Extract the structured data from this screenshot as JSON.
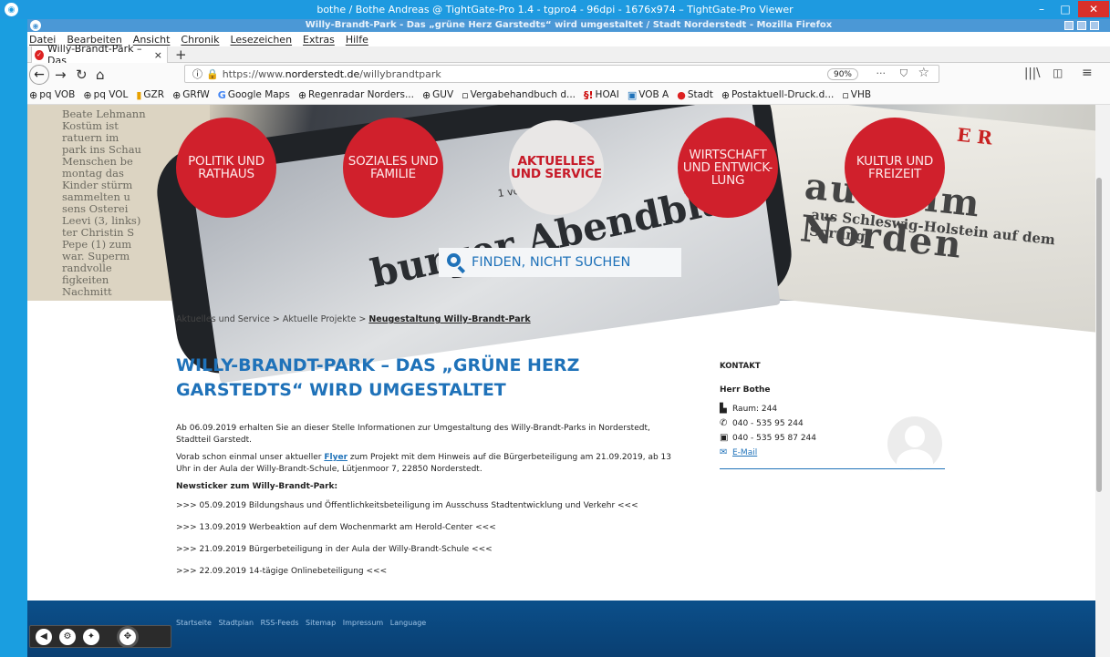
{
  "viewer": {
    "title": "bothe / Bothe Andreas @ TightGate-Pro 1.4 - tgpro4 - 96dpi - 1676x974 – TightGate-Pro Viewer",
    "minimize": "–",
    "maximize": "□",
    "close": "✕"
  },
  "firefox": {
    "title": "Willy-Brandt-Park - Das „grüne Herz Garstedts“ wird umgestaltet / Stadt Norderstedt - Mozilla Firefox"
  },
  "menu": [
    "Datei",
    "Bearbeiten",
    "Ansicht",
    "Chronik",
    "Lesezeichen",
    "Extras",
    "Hilfe"
  ],
  "tab": {
    "label": "Willy-Brandt-Park – Das",
    "close": "×",
    "new": "+"
  },
  "nav": {
    "url_prefix": "https://www.",
    "url_domain": "norderstedt.de",
    "url_path": "/willybrandtpark",
    "zoom": "90%",
    "more": "···"
  },
  "bookmarks": [
    {
      "icon": "⊕",
      "label": "pq VOB"
    },
    {
      "icon": "⊕",
      "label": "pq VOL"
    },
    {
      "icon": "▮",
      "label": "GZR"
    },
    {
      "icon": "⊕",
      "label": "GRfW"
    },
    {
      "icon": "G",
      "label": "Google Maps"
    },
    {
      "icon": "⊕",
      "label": "Regenradar Norders..."
    },
    {
      "icon": "⊕",
      "label": "GUV"
    },
    {
      "icon": "▫",
      "label": "Vergabehandbuch d..."
    },
    {
      "icon": "§!",
      "label": "HOAI"
    },
    {
      "icon": "▣",
      "label": "VOB A"
    },
    {
      "icon": "●",
      "label": "Stadt"
    },
    {
      "icon": "⊕",
      "label": "Postaktuell-Druck.d..."
    },
    {
      "icon": "▫",
      "label": "VHB"
    }
  ],
  "hero": {
    "circles": [
      {
        "label": "POLITIK UND RATHAUS",
        "active": false
      },
      {
        "label": "SOZIALES UND FAMILIE",
        "active": false
      },
      {
        "label": "AKTUELLES UND SERVICE",
        "active": true
      },
      {
        "label": "WIRTSCHAFT UND ENTWICK-LUNG",
        "active": false
      },
      {
        "label": "KULTUR UND FREIZEIT",
        "active": false
      }
    ],
    "search": "FINDEN, NICHT SUCHEN"
  },
  "breadcrumb": {
    "items": [
      "Aktuelles und Service",
      "Aktuelle Projekte"
    ],
    "sep": ">",
    "current": "Neugestaltung Willy-Brandt-Park"
  },
  "article": {
    "title_line1": "WILLY-BRANDT-PARK – DAS „GRÜNE HERZ",
    "title_line2": "GARSTEDTS“ WIRD UMGESTALTET",
    "p1": "Ab 06.09.2019 erhalten Sie an dieser Stelle Informationen zur Umgestaltung des Willy-Brandt-Parks in Norderstedt, Stadtteil Garstedt.",
    "p2_a": "Vorab schon einmal unser aktueller",
    "p2_link": "Flyer",
    "p2_b": "zum Projekt mit dem Hinweis auf die Bürgerbeteiligung am 21.09.2019, ab 13 Uhr in der Aula der Willy-Brandt-Schule, Lütjenmoor 7, 22850 Norderstedt.",
    "ticker_title": "Newsticker zum Willy-Brandt-Park:",
    "ticker": [
      ">>> 05.09.2019 Bildungshaus und Öffentlichkeitsbeteiligung im Ausschuss Stadtentwicklung und Verkehr <<<",
      ">>> 13.09.2019 Werbeaktion auf dem Wochenmarkt am Herold-Center <<<",
      ">>> 21.09.2019 Bürgerbeteiligung in der Aula der Willy-Brandt-Schule <<<",
      ">>> 22.09.2019 14-tägige Onlinebeteiligung <<<"
    ]
  },
  "contact": {
    "heading": "KONTAKT",
    "name": "Herr Bothe",
    "room": "Raum: 244",
    "phone": "040 - 535 95 244",
    "fax": "040 - 535 95 87 244",
    "email": "E-Mail"
  },
  "footer": {
    "links": [
      "Startseite",
      "Stadtplan",
      "RSS-Feeds",
      "Sitemap",
      "Impressum",
      "Language"
    ]
  },
  "colors": {
    "accent": "#1f72b9",
    "circle_red": "#d0202c",
    "viewer_blue": "#1e9ae0"
  }
}
